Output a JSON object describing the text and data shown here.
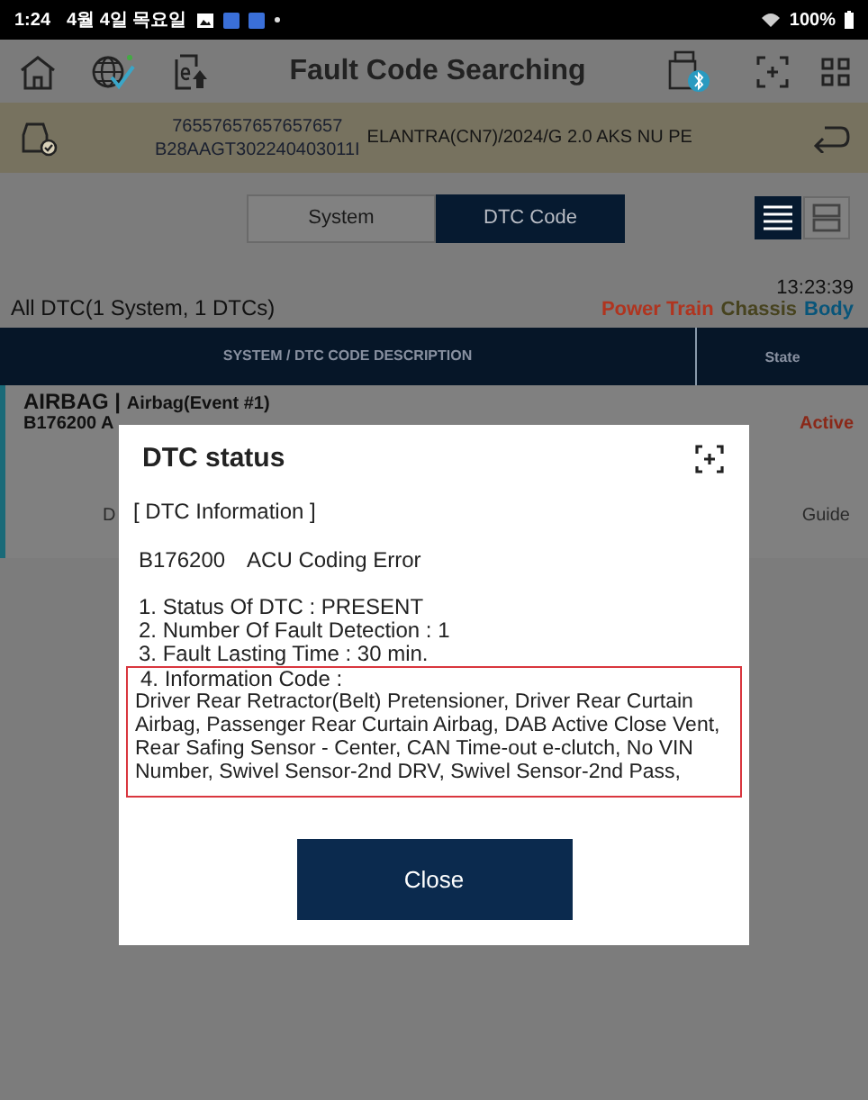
{
  "status_bar": {
    "time": "1:24",
    "date": "4월 4일 목요일",
    "battery": "100%"
  },
  "header": {
    "title": "Fault Code Searching"
  },
  "vehicle": {
    "ids": [
      "76557657657657657",
      "B28AAGT302240403011I"
    ],
    "model": "ELANTRA(CN7)/2024/G 2.0 AKS NU PE"
  },
  "tabs": [
    {
      "label": "System",
      "selected": false
    },
    {
      "label": "DTC Code",
      "selected": true
    }
  ],
  "view_toggles": [
    {
      "kind": "list",
      "selected": true
    },
    {
      "kind": "split",
      "selected": false
    }
  ],
  "summary": {
    "time": "13:23:39",
    "count": "All DTC(1 System, 1 DTCs)"
  },
  "categories": [
    {
      "label": "Power Train",
      "color": "#b0341f"
    },
    {
      "label": "Chassis",
      "color": "#47431f"
    },
    {
      "label": "Body",
      "color": "#08557a"
    }
  ],
  "table": {
    "columns": [
      "SYSTEM / DTC CODE DESCRIPTION",
      "State"
    ],
    "rows": [
      {
        "system": "AIRBAG |",
        "module": "Airbag(Event #1)",
        "code": "B176200 A",
        "state": "Active"
      }
    ],
    "footer": [
      "D",
      "Guide"
    ]
  },
  "dialog": {
    "title": "DTC status",
    "heading": "[ DTC Information ]",
    "code": "B176200",
    "description": "ACU Coding Error",
    "items": [
      "1. Status Of DTC : PRESENT",
      "2. Number Of Fault Detection : 1",
      "3. Fault Lasting Time : 30 min.",
      "4. Information Code :"
    ],
    "information": "Driver Rear Retractor(Belt) Pretensioner, Driver Rear Curtain Airbag, Passenger Rear Curtain Airbag, DAB Active Close Vent, Rear Safing Sensor - Center, CAN Time-out e-clutch, No VIN Number, Swivel Sensor-2nd DRV, Swivel Sensor-2nd Pass,",
    "button": "Close"
  }
}
